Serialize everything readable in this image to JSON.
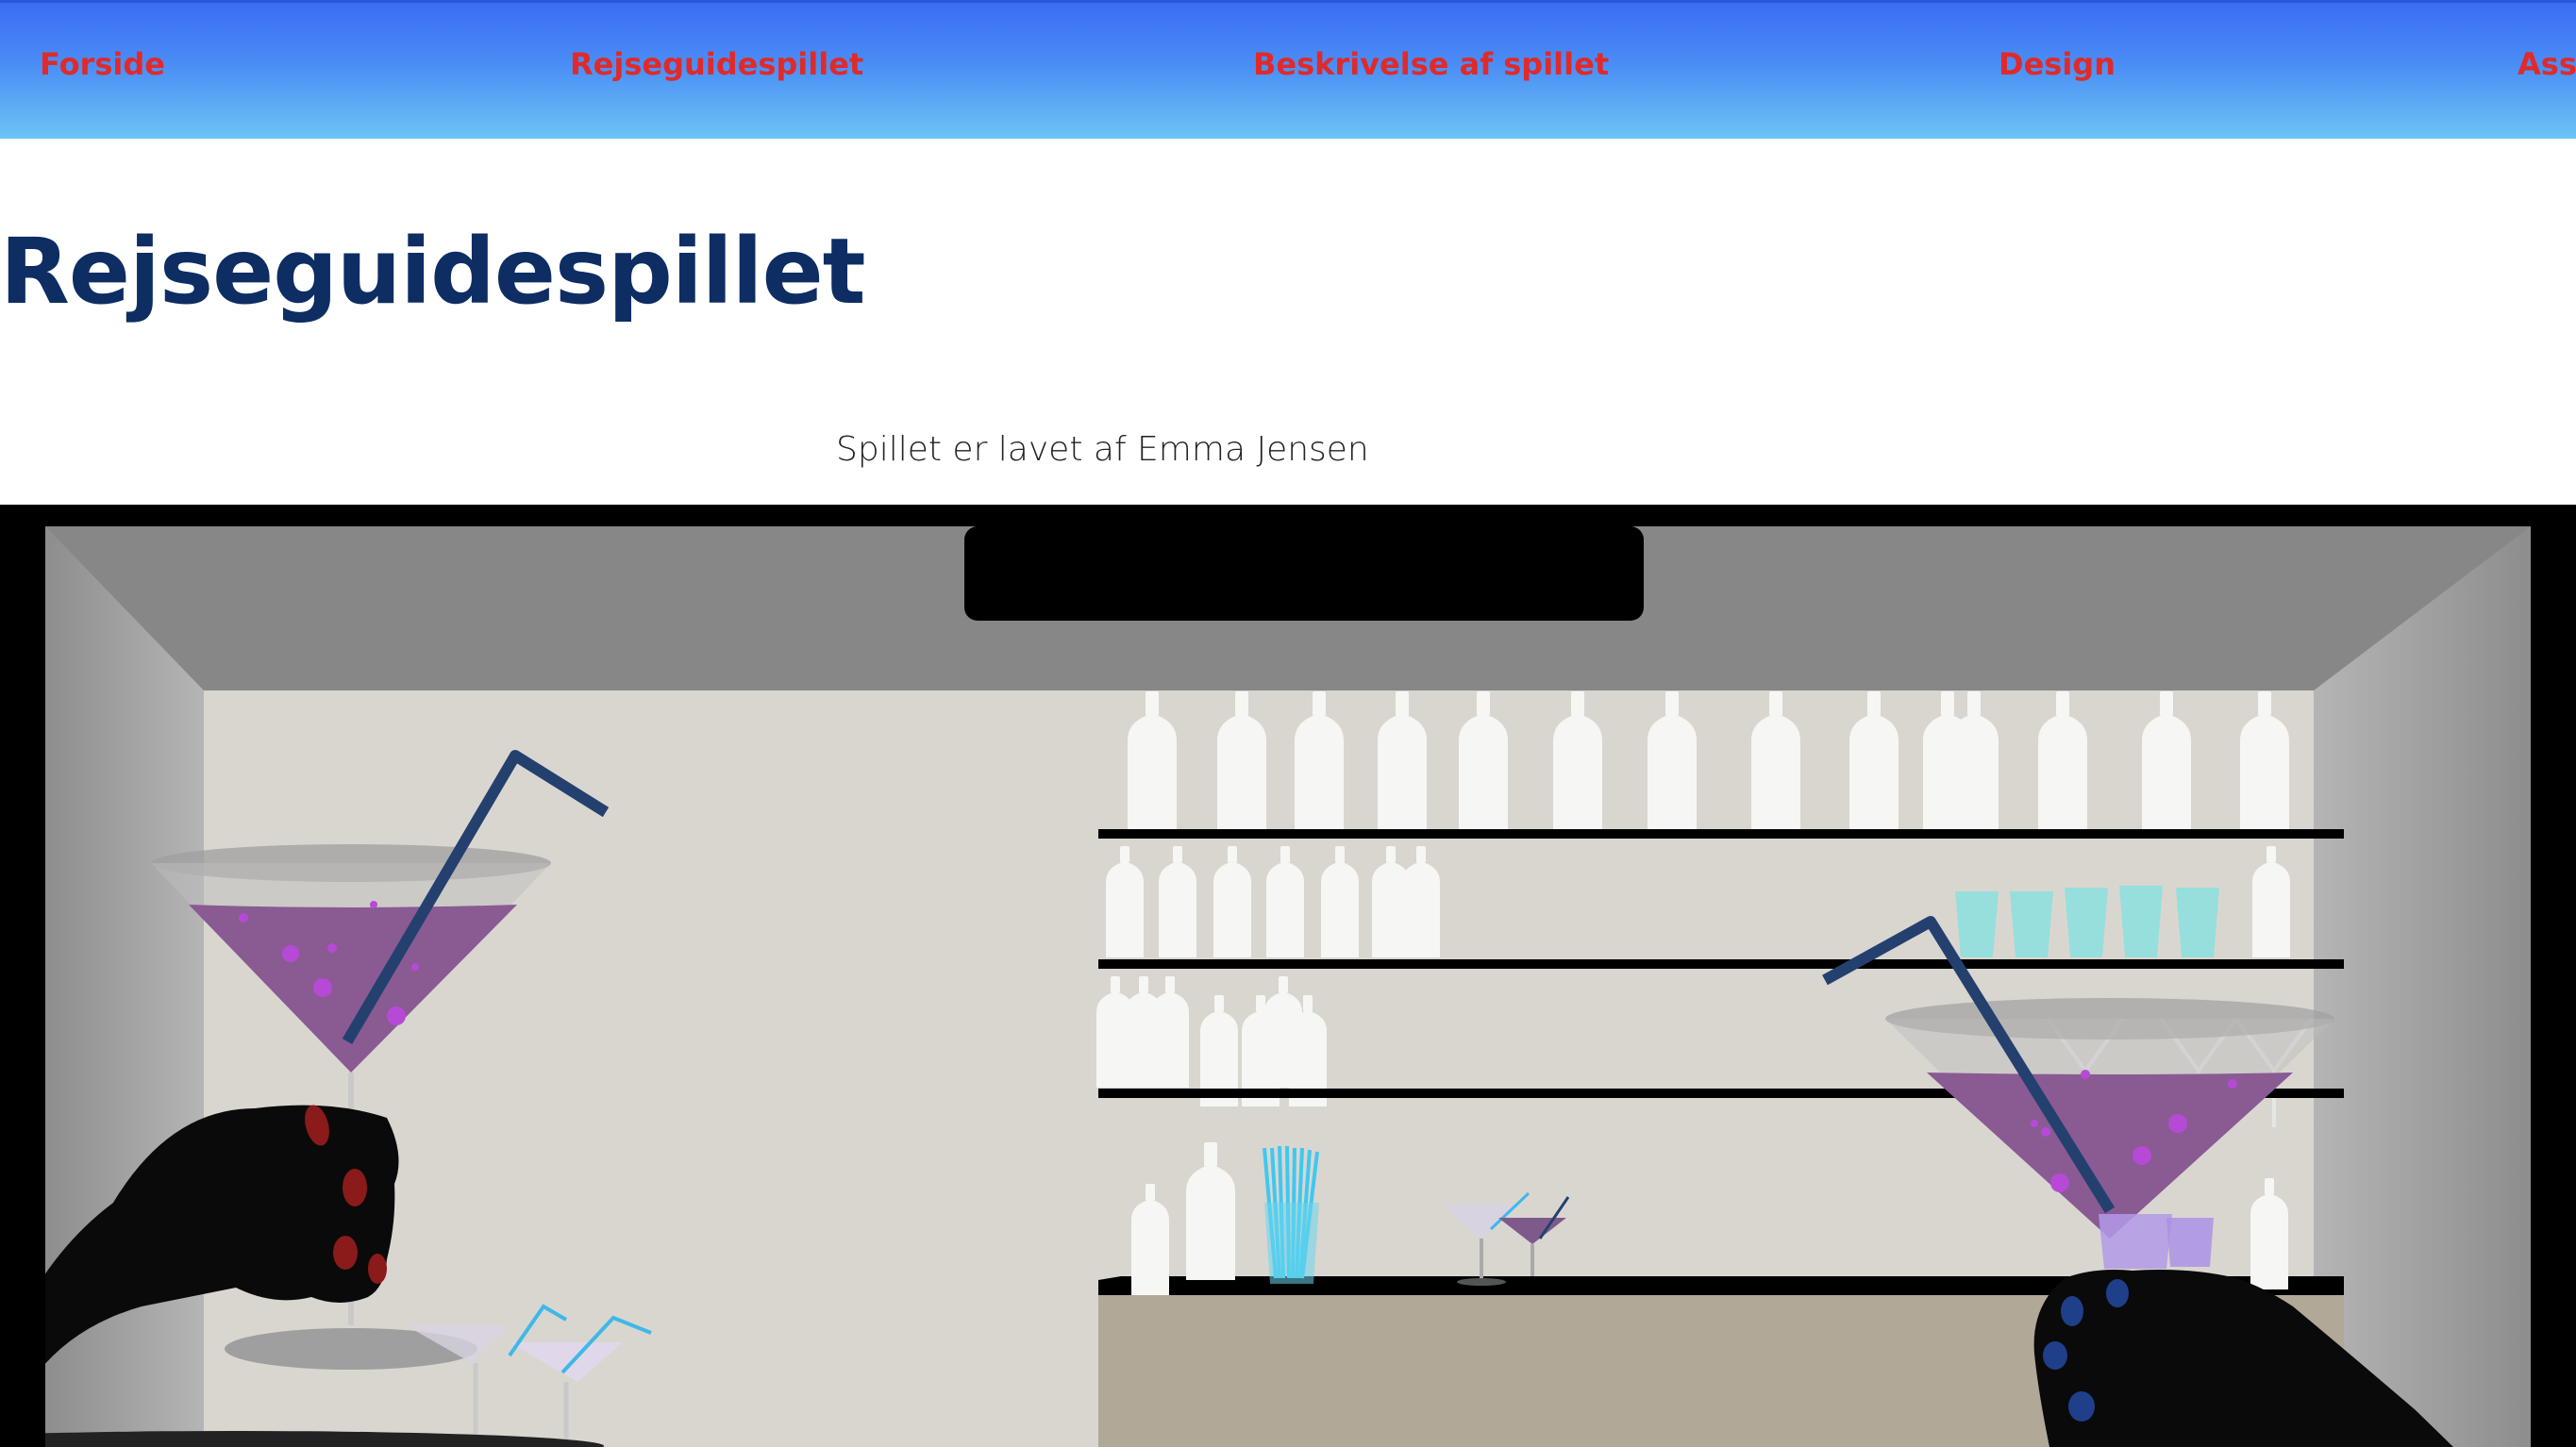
{
  "nav": {
    "items": [
      {
        "label": "Forside"
      },
      {
        "label": "Rejseguidespillet"
      },
      {
        "label": "Beskrivelse af spillet"
      },
      {
        "label": "Design"
      },
      {
        "label": "Ass"
      }
    ]
  },
  "page": {
    "title": "Rejseguidespillet",
    "byline": "Spillet er lavet af Emma Jensen"
  },
  "game": {
    "icon": "bar-scene-illustration",
    "colors": {
      "drink": "#8a5a93",
      "straw": "#24406e",
      "wall": "#d9d6d0",
      "ceiling": "#878787",
      "shelf": "#000000",
      "counter": "#b1a898",
      "nail_left": "#8b1a1a",
      "nail_right": "#1f3f8a",
      "shot_glass": "#7fd8d8"
    }
  }
}
